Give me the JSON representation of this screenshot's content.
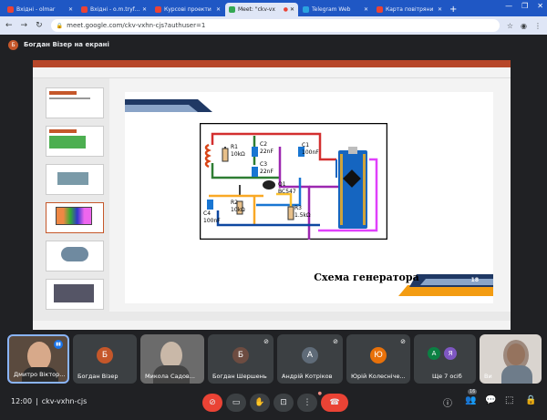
{
  "browser": {
    "tabs": [
      {
        "label": "Вхідні - olmar",
        "color": "#ea4335",
        "active": false
      },
      {
        "label": "Вхідні - o.m.tryfon",
        "color": "#ea4335",
        "active": false
      },
      {
        "label": "Курсові проекти",
        "color": "#ea4335",
        "active": false
      },
      {
        "label": "Meet: \"ckv-vx",
        "color": "#34a853",
        "active": true
      },
      {
        "label": "Telegram Web",
        "color": "#2aa3e0",
        "active": false
      },
      {
        "label": "Карта повітряни",
        "color": "#ea4335",
        "active": false
      }
    ],
    "url": "meet.google.com/ckv-vxhn-cjs?authuser=1"
  },
  "presenting": {
    "initial": "Б",
    "text": "Богдан Візер на екрані"
  },
  "slide": {
    "caption": "Схема генератора",
    "number": "18",
    "components": {
      "r1": "R1",
      "r1v": "10kΩ",
      "c2": "C2",
      "c2v": "22nF",
      "c1": "C1",
      "c1v": "100nF",
      "c3": "C3",
      "c3v": "22nF",
      "q1": "Q1",
      "q1v": "BC547",
      "c4": "C4",
      "c4v": "100nF",
      "r2": "R2",
      "r2v": "10kΩ",
      "r3": "R3",
      "r3v": "1.5kΩ"
    }
  },
  "participants": [
    {
      "name": "Дмитро Віктор...",
      "initial": "",
      "color": "#5a4a3e",
      "video": true
    },
    {
      "name": "Богдан Візер",
      "initial": "Б",
      "color": "#c5572a",
      "video": false
    },
    {
      "name": "Микола Садов...",
      "initial": "",
      "color": "#6b6b6b",
      "video": true
    },
    {
      "name": "Богдан Шершень",
      "initial": "Б",
      "color": "#6d4c41",
      "video": false
    },
    {
      "name": "Андрій Котріков",
      "initial": "А",
      "color": "#5f6b78",
      "video": false
    },
    {
      "name": "Юрій Колесніче...",
      "initial": "Ю",
      "color": "#e8710a",
      "video": false
    },
    {
      "name": "Ще 7 осіб",
      "initial": "",
      "color": "#3c4043",
      "video": false
    },
    {
      "name": "Ви",
      "initial": "",
      "color": "#8d8d8d",
      "video": true
    }
  ],
  "more_avatars": [
    "А",
    "Я"
  ],
  "controls": {
    "time": "12:00",
    "separator": "|",
    "meeting_code": "ckv-vxhn-cjs",
    "people_count": "16"
  },
  "colors": {
    "accent_red": "#ea4335",
    "bar": "#202124",
    "tile": "#3c4043"
  }
}
